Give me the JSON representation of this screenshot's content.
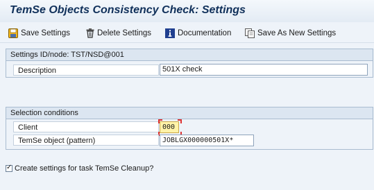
{
  "window": {
    "title": "TemSe Objects Consistency Check: Settings"
  },
  "toolbar": {
    "save": "Save Settings",
    "delete": "Delete Settings",
    "documentation": "Documentation",
    "save_as_new": "Save As New Settings"
  },
  "settings_group": {
    "header": "Settings ID/node: TST/NSD@001",
    "description_label": "Description",
    "description_value": "501X check"
  },
  "selection_group": {
    "header": "Selection conditions",
    "client_label": "Client",
    "client_value": "000",
    "temse_label": "TemSe object (pattern)",
    "temse_value": "JOBLGX000000501X*"
  },
  "cleanup": {
    "label": "Create settings for task TemSe Cleanup?",
    "checked": true,
    "check_mark": "✓"
  },
  "colors": {
    "title_text": "#10305a",
    "panel_background": "#eef3f9",
    "group_border": "#a9bcd0",
    "focus_field": "#fff3a8"
  }
}
